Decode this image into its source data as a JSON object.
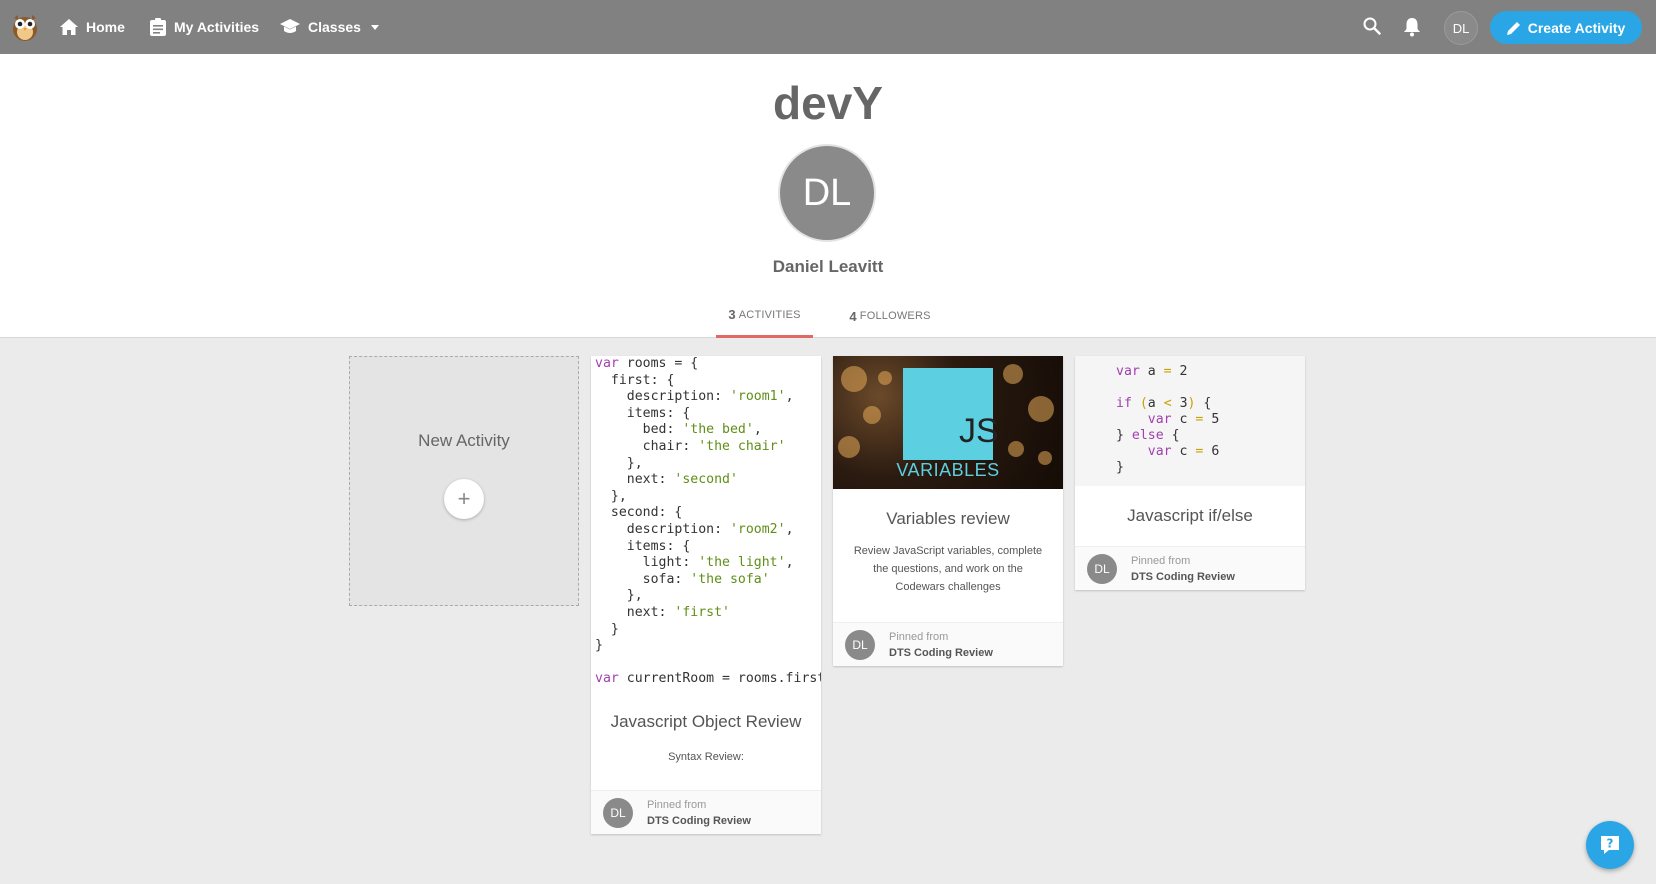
{
  "nav": {
    "home": "Home",
    "my_activities": "My Activities",
    "classes": "Classes",
    "avatar_initials": "DL",
    "create_activity": "Create Activity"
  },
  "profile": {
    "username": "devY",
    "initials": "DL",
    "full_name": "Daniel Leavitt",
    "tabs": [
      {
        "count": "3",
        "label": "ACTIVITIES",
        "active": true
      },
      {
        "count": "4",
        "label": "FOLLOWERS",
        "active": false
      }
    ]
  },
  "new_activity": {
    "label": "New Activity",
    "plus": "+"
  },
  "cards": [
    {
      "title": "Javascript Object Review",
      "description": "Syntax Review:",
      "pinned_label": "Pinned from",
      "source": "DTS Coding Review",
      "initials": "DL"
    },
    {
      "title": "Variables review",
      "description": "Review JavaScript variables, complete the questions, and work on the Codewars challenges",
      "pinned_label": "Pinned from",
      "source": "DTS Coding Review",
      "initials": "DL",
      "image_text_big": "JS",
      "image_text_small": "VARIABLES"
    },
    {
      "title": "Javascript if/else",
      "pinned_label": "Pinned from",
      "source": "DTS Coding Review",
      "initials": "DL"
    }
  ],
  "colors": {
    "nav_bg": "#818181",
    "accent_blue": "#2aa5e6",
    "tab_underline": "#e06a63",
    "avatar_gray": "#8a8a8a"
  }
}
